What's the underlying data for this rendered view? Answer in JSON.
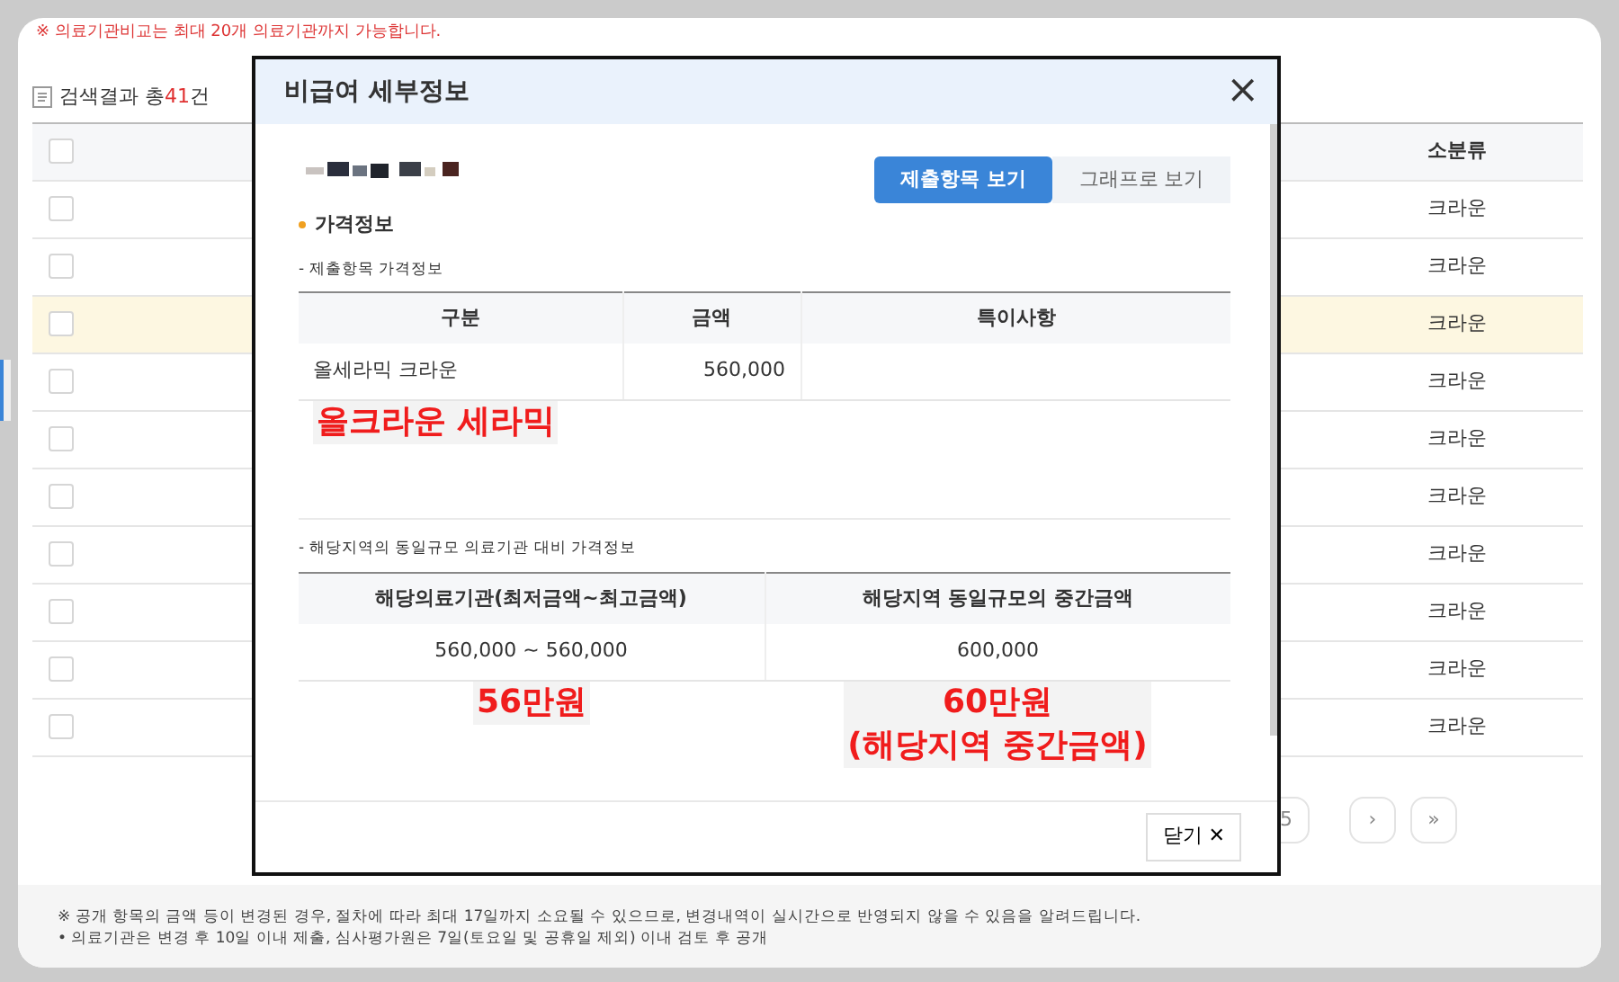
{
  "notice": "※ 의료기관비교는 최대 20개 의료기관까지 가능합니다.",
  "result_count": {
    "prefix": "검색결과 총",
    "count": "41",
    "suffix": "건"
  },
  "table": {
    "header_checkbox": {
      "checked": false
    },
    "columns": [
      {
        "label": "소분류"
      }
    ],
    "rows": [
      {
        "subcategory": "크라운",
        "checked": false,
        "selected": false
      },
      {
        "subcategory": "크라운",
        "checked": false,
        "selected": false
      },
      {
        "subcategory": "크라운",
        "checked": false,
        "selected": true
      },
      {
        "subcategory": "크라운",
        "checked": false,
        "selected": false
      },
      {
        "subcategory": "크라운",
        "checked": false,
        "selected": false
      },
      {
        "subcategory": "크라운",
        "checked": false,
        "selected": false
      },
      {
        "subcategory": "크라운",
        "checked": false,
        "selected": false
      },
      {
        "subcategory": "크라운",
        "checked": false,
        "selected": false
      },
      {
        "subcategory": "크라운",
        "checked": false,
        "selected": false
      },
      {
        "subcategory": "크라운",
        "checked": false,
        "selected": false
      }
    ]
  },
  "pagination": {
    "page": "5",
    "next": "›",
    "last": "»"
  },
  "modal": {
    "title": "비급여 세부정보",
    "close": "×",
    "views": [
      {
        "label": "제출항목 보기",
        "selected": true
      },
      {
        "label": "그래프로 보기",
        "selected": false
      }
    ],
    "section_title": "가격정보",
    "submitted": {
      "subtitle": "- 제출항목 가격정보",
      "columns": [
        "구분",
        "금액",
        "특이사항"
      ],
      "rows": [
        [
          "올세라믹 크라운",
          "560,000",
          ""
        ]
      ],
      "annotation": "올크라운 세라믹"
    },
    "regional": {
      "subtitle": "- 해당지역의 동일규모 의료기관 대비 가격정보",
      "columns": [
        "해당의료기관(최저금액~최고금액)",
        "해당지역 동일규모의 중간금액"
      ],
      "rows": [
        [
          "560,000 ~ 560,000",
          "600,000"
        ]
      ],
      "annotations": [
        [
          "56만원"
        ],
        [
          "60만원",
          "(해당지역 중간금액)"
        ]
      ]
    },
    "close_button": {
      "label": "닫기",
      "icon": "✕"
    }
  },
  "footnotes": [
    "※ 공개 항목의 금액 등이 변경된 경우, 절차에 따라 최대 17일까지 소요될 수 있으므로, 변경내역이 실시간으로 반영되지 않을 수 있음을 알려드립니다.",
    "• 의료기관은 변경 후 10일 이내 제출, 심사평가원은 7일(토요일 및 공휴일 제외) 이내 검토 후 공개"
  ]
}
